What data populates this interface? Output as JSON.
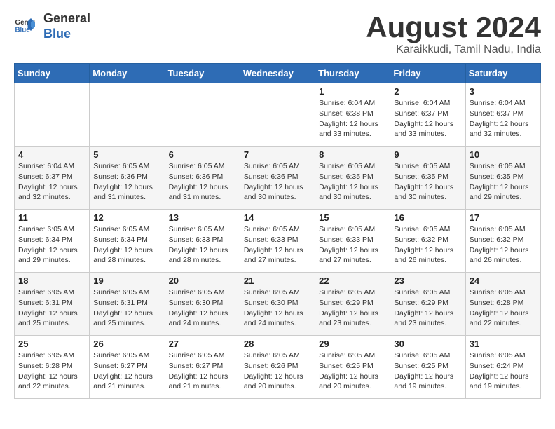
{
  "header": {
    "logo_general": "General",
    "logo_blue": "Blue",
    "title": "August 2024",
    "subtitle": "Karaikkudi, Tamil Nadu, India"
  },
  "calendar": {
    "days_of_week": [
      "Sunday",
      "Monday",
      "Tuesday",
      "Wednesday",
      "Thursday",
      "Friday",
      "Saturday"
    ],
    "weeks": [
      [
        {
          "day": "",
          "info": ""
        },
        {
          "day": "",
          "info": ""
        },
        {
          "day": "",
          "info": ""
        },
        {
          "day": "",
          "info": ""
        },
        {
          "day": "1",
          "info": "Sunrise: 6:04 AM\nSunset: 6:38 PM\nDaylight: 12 hours\nand 33 minutes."
        },
        {
          "day": "2",
          "info": "Sunrise: 6:04 AM\nSunset: 6:37 PM\nDaylight: 12 hours\nand 33 minutes."
        },
        {
          "day": "3",
          "info": "Sunrise: 6:04 AM\nSunset: 6:37 PM\nDaylight: 12 hours\nand 32 minutes."
        }
      ],
      [
        {
          "day": "4",
          "info": "Sunrise: 6:04 AM\nSunset: 6:37 PM\nDaylight: 12 hours\nand 32 minutes."
        },
        {
          "day": "5",
          "info": "Sunrise: 6:05 AM\nSunset: 6:36 PM\nDaylight: 12 hours\nand 31 minutes."
        },
        {
          "day": "6",
          "info": "Sunrise: 6:05 AM\nSunset: 6:36 PM\nDaylight: 12 hours\nand 31 minutes."
        },
        {
          "day": "7",
          "info": "Sunrise: 6:05 AM\nSunset: 6:36 PM\nDaylight: 12 hours\nand 30 minutes."
        },
        {
          "day": "8",
          "info": "Sunrise: 6:05 AM\nSunset: 6:35 PM\nDaylight: 12 hours\nand 30 minutes."
        },
        {
          "day": "9",
          "info": "Sunrise: 6:05 AM\nSunset: 6:35 PM\nDaylight: 12 hours\nand 30 minutes."
        },
        {
          "day": "10",
          "info": "Sunrise: 6:05 AM\nSunset: 6:35 PM\nDaylight: 12 hours\nand 29 minutes."
        }
      ],
      [
        {
          "day": "11",
          "info": "Sunrise: 6:05 AM\nSunset: 6:34 PM\nDaylight: 12 hours\nand 29 minutes."
        },
        {
          "day": "12",
          "info": "Sunrise: 6:05 AM\nSunset: 6:34 PM\nDaylight: 12 hours\nand 28 minutes."
        },
        {
          "day": "13",
          "info": "Sunrise: 6:05 AM\nSunset: 6:33 PM\nDaylight: 12 hours\nand 28 minutes."
        },
        {
          "day": "14",
          "info": "Sunrise: 6:05 AM\nSunset: 6:33 PM\nDaylight: 12 hours\nand 27 minutes."
        },
        {
          "day": "15",
          "info": "Sunrise: 6:05 AM\nSunset: 6:33 PM\nDaylight: 12 hours\nand 27 minutes."
        },
        {
          "day": "16",
          "info": "Sunrise: 6:05 AM\nSunset: 6:32 PM\nDaylight: 12 hours\nand 26 minutes."
        },
        {
          "day": "17",
          "info": "Sunrise: 6:05 AM\nSunset: 6:32 PM\nDaylight: 12 hours\nand 26 minutes."
        }
      ],
      [
        {
          "day": "18",
          "info": "Sunrise: 6:05 AM\nSunset: 6:31 PM\nDaylight: 12 hours\nand 25 minutes."
        },
        {
          "day": "19",
          "info": "Sunrise: 6:05 AM\nSunset: 6:31 PM\nDaylight: 12 hours\nand 25 minutes."
        },
        {
          "day": "20",
          "info": "Sunrise: 6:05 AM\nSunset: 6:30 PM\nDaylight: 12 hours\nand 24 minutes."
        },
        {
          "day": "21",
          "info": "Sunrise: 6:05 AM\nSunset: 6:30 PM\nDaylight: 12 hours\nand 24 minutes."
        },
        {
          "day": "22",
          "info": "Sunrise: 6:05 AM\nSunset: 6:29 PM\nDaylight: 12 hours\nand 23 minutes."
        },
        {
          "day": "23",
          "info": "Sunrise: 6:05 AM\nSunset: 6:29 PM\nDaylight: 12 hours\nand 23 minutes."
        },
        {
          "day": "24",
          "info": "Sunrise: 6:05 AM\nSunset: 6:28 PM\nDaylight: 12 hours\nand 22 minutes."
        }
      ],
      [
        {
          "day": "25",
          "info": "Sunrise: 6:05 AM\nSunset: 6:28 PM\nDaylight: 12 hours\nand 22 minutes."
        },
        {
          "day": "26",
          "info": "Sunrise: 6:05 AM\nSunset: 6:27 PM\nDaylight: 12 hours\nand 21 minutes."
        },
        {
          "day": "27",
          "info": "Sunrise: 6:05 AM\nSunset: 6:27 PM\nDaylight: 12 hours\nand 21 minutes."
        },
        {
          "day": "28",
          "info": "Sunrise: 6:05 AM\nSunset: 6:26 PM\nDaylight: 12 hours\nand 20 minutes."
        },
        {
          "day": "29",
          "info": "Sunrise: 6:05 AM\nSunset: 6:25 PM\nDaylight: 12 hours\nand 20 minutes."
        },
        {
          "day": "30",
          "info": "Sunrise: 6:05 AM\nSunset: 6:25 PM\nDaylight: 12 hours\nand 19 minutes."
        },
        {
          "day": "31",
          "info": "Sunrise: 6:05 AM\nSunset: 6:24 PM\nDaylight: 12 hours\nand 19 minutes."
        }
      ]
    ]
  }
}
